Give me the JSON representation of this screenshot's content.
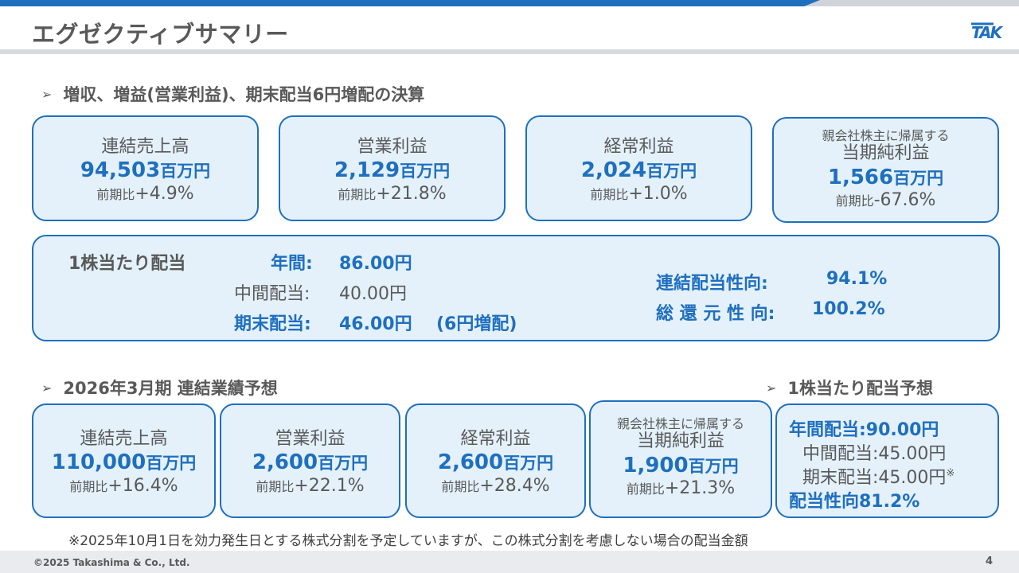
{
  "header": {
    "title": "エグゼクティブサマリー",
    "logo_text": "TAK"
  },
  "section1": {
    "heading": "増収、増益(営業利益)、期末配当6円増配の決算",
    "bullet": "➢",
    "cards": [
      {
        "label": "連結売上高",
        "value": "94,503",
        "unit": "百万円",
        "prefix": "前期比",
        "change": "+4.9%"
      },
      {
        "label": "営業利益",
        "value": "2,129",
        "unit": "百万円",
        "prefix": "前期比",
        "change": "+21.8%"
      },
      {
        "label": "経常利益",
        "value": "2,024",
        "unit": "百万円",
        "prefix": "前期比",
        "change": "+1.0%"
      },
      {
        "sublabel": "親会社株主に帰属する",
        "label": "当期純利益",
        "value": "1,566",
        "unit": "百万円",
        "prefix": "前期比",
        "change": "-67.6%"
      }
    ]
  },
  "dividend": {
    "title": "1株当たり配当",
    "annual_label": "年間:",
    "annual_value": "86.00円",
    "interim_label": "中間配当:",
    "interim_value": "40.00円",
    "yearend_label": "期末配当:",
    "yearend_value": "46.00円",
    "yearend_note": "(6円増配)",
    "payout_label": "連結配当性向:",
    "payout_value": "94.1%",
    "total_return_label": "総 還 元 性 向:",
    "total_return_value": "100.2%"
  },
  "section2": {
    "heading": "2026年3月期 連結業績予想",
    "bullet": "➢",
    "cards": [
      {
        "label": "連結売上高",
        "value": "110,000",
        "unit": "百万円",
        "prefix": "前期比",
        "change": "+16.4%"
      },
      {
        "label": "営業利益",
        "value": "2,600",
        "unit": "百万円",
        "prefix": "前期比",
        "change": "+22.1%"
      },
      {
        "label": "経常利益",
        "value": "2,600",
        "unit": "百万円",
        "prefix": "前期比",
        "change": "+28.4%"
      },
      {
        "sublabel": "親会社株主に帰属する",
        "label": "当期純利益",
        "value": "1,900",
        "unit": "百万円",
        "prefix": "前期比",
        "change": "+21.3%"
      }
    ]
  },
  "forecast_dividend": {
    "heading": "1株当たり配当予想",
    "bullet": "➢",
    "annual": "年間配当:90.00円",
    "interim": "中間配当:45.00円",
    "yearend": "期末配当:45.00円",
    "yearend_mark": "※",
    "payout": "配当性向81.2%"
  },
  "footnote": "※2025年10月1日を効力発生日とする株式分割を予定していますが、この株式分割を考慮しない場合の配当金額",
  "footer": {
    "copyright": "©2025 Takashima & Co., Ltd.",
    "page_number": "4"
  }
}
